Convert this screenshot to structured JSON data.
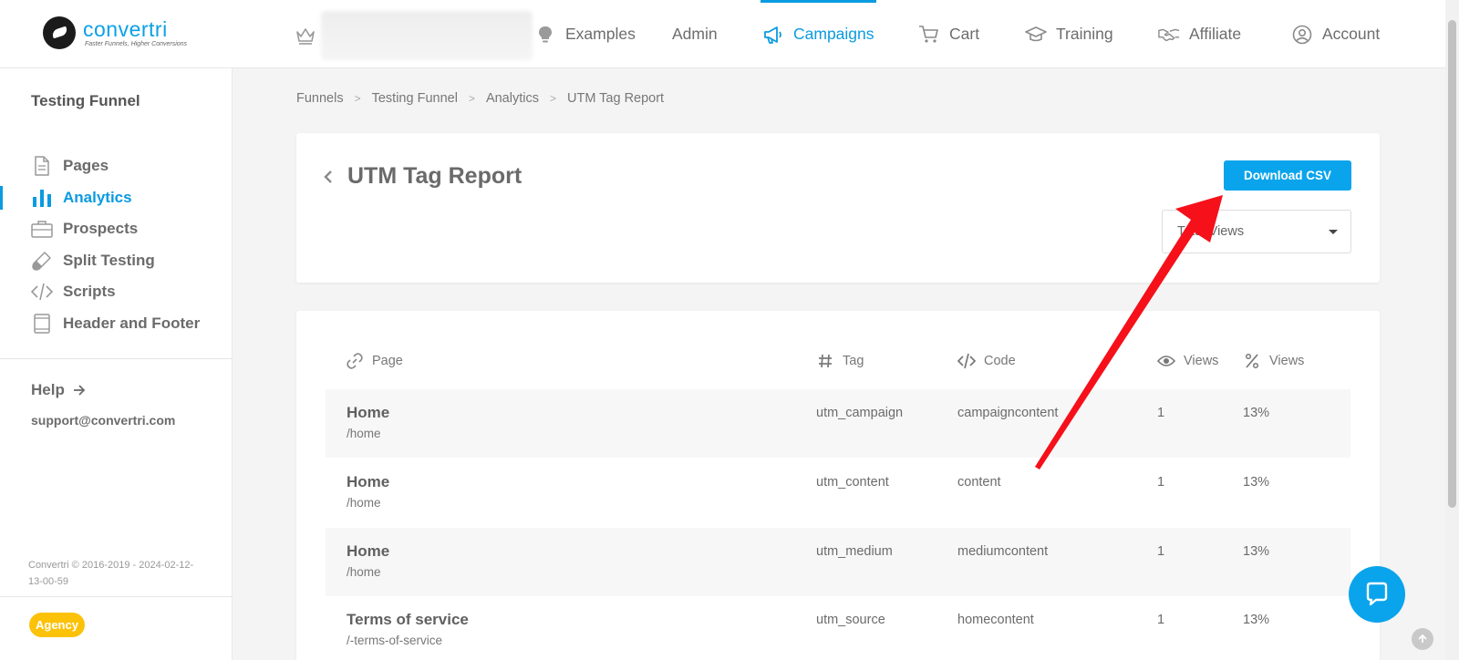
{
  "brand": {
    "name": "convertri",
    "tagline": "Faster Funnels, Higher Conversions",
    "accent": "#0a9be0"
  },
  "topnav": {
    "items": [
      {
        "label": "Examples",
        "icon": "lightbulb-icon"
      },
      {
        "label": "Admin",
        "icon": ""
      },
      {
        "label": "Campaigns",
        "icon": "megaphone-icon",
        "active": true
      },
      {
        "label": "Cart",
        "icon": "cart-icon"
      },
      {
        "label": "Training",
        "icon": "graduation-cap-icon"
      },
      {
        "label": "Affiliate",
        "icon": "handshake-icon"
      },
      {
        "label": "Account",
        "icon": "user-circle-icon"
      }
    ]
  },
  "sidebar": {
    "title": "Testing Funnel",
    "items": [
      {
        "label": "Pages",
        "icon": "document-icon"
      },
      {
        "label": "Analytics",
        "icon": "bar-chart-icon",
        "active": true
      },
      {
        "label": "Prospects",
        "icon": "briefcase-icon"
      },
      {
        "label": "Split Testing",
        "icon": "test-tube-icon"
      },
      {
        "label": "Scripts",
        "icon": "code-icon"
      },
      {
        "label": "Header and Footer",
        "icon": "book-icon"
      }
    ],
    "help_label": "Help",
    "support_email": "support@convertri.com",
    "copyright_line1": "Convertri © 2016-2019 - 2024-02-12-",
    "copyright_line2": "13-00-59",
    "badge": "Agency"
  },
  "breadcrumb": [
    "Funnels",
    "Testing Funnel",
    "Analytics",
    "UTM Tag Report"
  ],
  "report": {
    "title": "UTM Tag Report",
    "download_label": "Download CSV",
    "select_value": "Total Views"
  },
  "table": {
    "headers": {
      "page": "Page",
      "tag": "Tag",
      "code": "Code",
      "views": "Views",
      "pct_views": "Views"
    },
    "rows": [
      {
        "name": "Home",
        "path": "/home",
        "tag": "utm_campaign",
        "code": "campaigncontent",
        "views": "1",
        "pct": "13%"
      },
      {
        "name": "Home",
        "path": "/home",
        "tag": "utm_content",
        "code": "content",
        "views": "1",
        "pct": "13%"
      },
      {
        "name": "Home",
        "path": "/home",
        "tag": "utm_medium",
        "code": "mediumcontent",
        "views": "1",
        "pct": "13%"
      },
      {
        "name": "Terms of service",
        "path": "/-terms-of-service",
        "tag": "utm_source",
        "code": "homecontent",
        "views": "1",
        "pct": "13%"
      }
    ]
  }
}
